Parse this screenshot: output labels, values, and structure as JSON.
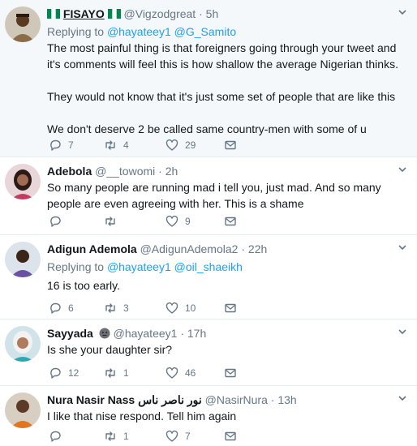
{
  "tweets": [
    {
      "display_name_pre": "",
      "display_name": "FISAYO",
      "display_name_post": "",
      "flags": true,
      "handle": "@Vigzodgreat",
      "dot": "·",
      "time": "5h",
      "replying_prefix": "Replying to",
      "replying_to": [
        "@hayateey1",
        "@G_Samito"
      ],
      "text": [
        "The most painful thing is that foreigners going through your tweet and it's comments will feel this is how shallow the average Nigerian thinks.",
        "",
        "They would not know that it's just some set of people that are like this",
        "",
        "We don't deserve 2 be called same country-men with some of u"
      ],
      "replies": "7",
      "retweets": "4",
      "likes": "29",
      "highlighted": true
    },
    {
      "display_name": "Adebola",
      "handle": "@__towomi",
      "dot": "·",
      "time": "2h",
      "text": [
        "So many people are running mad i tell you, just mad. And so many people are even agreeing with her. This is a shame"
      ],
      "replies": "",
      "retweets": "",
      "likes": "9",
      "highlighted": false
    },
    {
      "display_name": "Adigun Ademola",
      "handle": "@AdigunAdemola2",
      "dot": "·",
      "time": "22h",
      "replying_prefix": "Replying to",
      "replying_to": [
        "@hayateey1",
        "@oil_shaeikh"
      ],
      "text": [
        "16 is too early."
      ],
      "replies": "6",
      "retweets": "3",
      "likes": "10",
      "highlighted": false
    },
    {
      "display_name": "Sayyada",
      "handle": "@hayateey1",
      "dot": "·",
      "time": "17h",
      "text": [
        "Is she your daughter sir?"
      ],
      "replies": "12",
      "retweets": "1",
      "likes": "46",
      "highlighted": false
    },
    {
      "display_name": "Nura Nasir Nass نور ناصر ناس",
      "handle": "@NasirNura",
      "dot": "·",
      "time": "13h",
      "text": [
        "I like that nise respond. Tell him again"
      ],
      "replies": "",
      "retweets": "1",
      "likes": "7",
      "highlighted": false
    }
  ],
  "colors": {
    "accent": "#1da1f2",
    "muted": "#657786",
    "text": "#14171a",
    "divider": "#e6ecf0",
    "highlight_bg": "#f5f8fa"
  },
  "icons": [
    "reply-icon",
    "retweet-icon",
    "like-icon",
    "message-icon",
    "chevron-down-icon"
  ]
}
